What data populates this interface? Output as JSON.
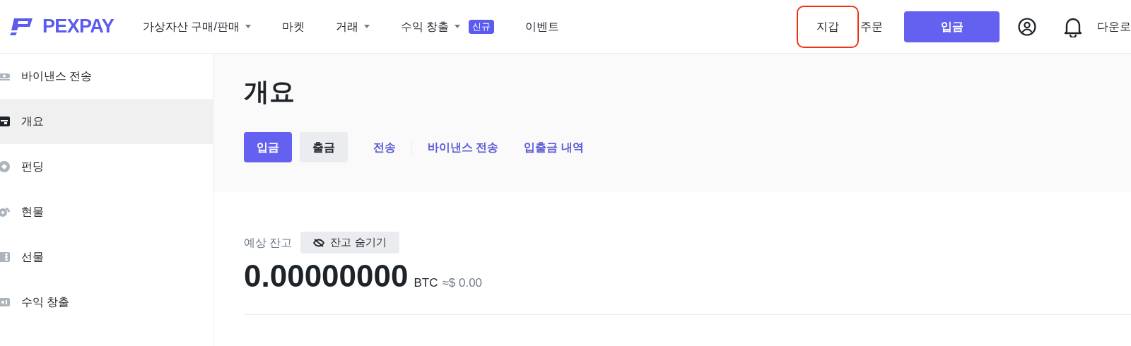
{
  "header": {
    "logo": "PEXPAY",
    "nav": [
      {
        "label": "가상자산 구매/판매",
        "dropdown": true
      },
      {
        "label": "마켓",
        "dropdown": false
      },
      {
        "label": "거래",
        "dropdown": true
      },
      {
        "label": "수익 창출",
        "dropdown": true,
        "badge": "신규"
      },
      {
        "label": "이벤트",
        "dropdown": false
      }
    ],
    "right_links": [
      {
        "label": "지갑",
        "highlighted": true
      },
      {
        "label": "주문",
        "highlighted": false
      }
    ],
    "deposit_button": "입금",
    "download": "다운로"
  },
  "sidebar": {
    "items": [
      {
        "label": "바이낸스 전송",
        "selected": false
      },
      {
        "label": "개요",
        "selected": true
      },
      {
        "label": "펀딩",
        "selected": false
      },
      {
        "label": "현물",
        "selected": false
      },
      {
        "label": "선물",
        "selected": false
      },
      {
        "label": "수익 창출",
        "selected": false
      }
    ]
  },
  "page": {
    "title": "개요",
    "actions": [
      {
        "label": "입금",
        "kind": "primary"
      },
      {
        "label": "출금",
        "kind": "secondary"
      },
      {
        "label": "전송",
        "kind": "link"
      },
      {
        "kind": "divider"
      },
      {
        "label": "바이낸스 전송",
        "kind": "link"
      },
      {
        "label": "입출금 내역",
        "kind": "link"
      }
    ],
    "balance": {
      "label": "예상 잔고",
      "hide_button": "잔고 숨기기",
      "amount": "0.00000000",
      "unit": "BTC",
      "fiat": "≈$ 0.00"
    }
  }
}
